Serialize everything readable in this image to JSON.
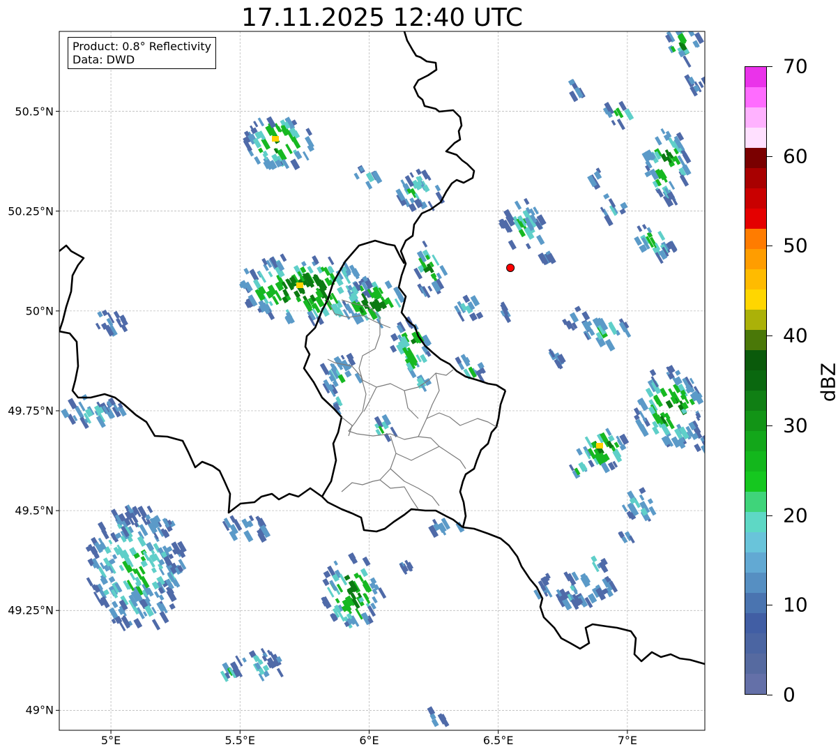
{
  "title": "17.11.2025 12:40 UTC",
  "info": {
    "product": "Product: 0.8° Reflectivity",
    "source": "Data: DWD"
  },
  "axes": {
    "lat_ticks": [
      "50.5°N",
      "50.25°N",
      "50°N",
      "49.75°N",
      "49.5°N",
      "49.25°N",
      "49°N"
    ],
    "lon_ticks": [
      "5°E",
      "5.5°E",
      "6°E",
      "6.5°E",
      "7°E"
    ],
    "extent": {
      "lon_min": 4.8,
      "lon_max": 7.3,
      "lat_min": 48.95,
      "lat_max": 50.7
    },
    "grid": true
  },
  "colorbar": {
    "unit": "dBZ",
    "ticks": [
      "0",
      "10",
      "20",
      "30",
      "40",
      "50",
      "60",
      "70"
    ],
    "min": 0,
    "max": 70,
    "step": 2.5,
    "colors": [
      "#6470a8",
      "#566aa0",
      "#4b65a2",
      "#415ea4",
      "#4a74b0",
      "#568fc2",
      "#62a9d3",
      "#69c4da",
      "#5ed8c5",
      "#3fd47a",
      "#15c71f",
      "#13b71c",
      "#13a71a",
      "#129416",
      "#107f14",
      "#0a680f",
      "#0a5a0b",
      "#4a7808",
      "#abb108",
      "#ffd600",
      "#ffbb00",
      "#ff9d00",
      "#ff7c00",
      "#e40000",
      "#c90000",
      "#a80000",
      "#7a0000",
      "#ffe0ff",
      "#ffb2ff",
      "#ff6cff",
      "#ea33ea"
    ]
  },
  "marker": {
    "name": "radar-site",
    "lon": 6.547,
    "lat": 50.108,
    "color": "#ff0000"
  },
  "echo_colors": {
    "weak": "#4f6aa8",
    "light": "#5b9ac8",
    "cyan": "#5fcfc9",
    "green": "#16b821",
    "dark": "#0b7a12",
    "yellow": "#ffd200"
  }
}
